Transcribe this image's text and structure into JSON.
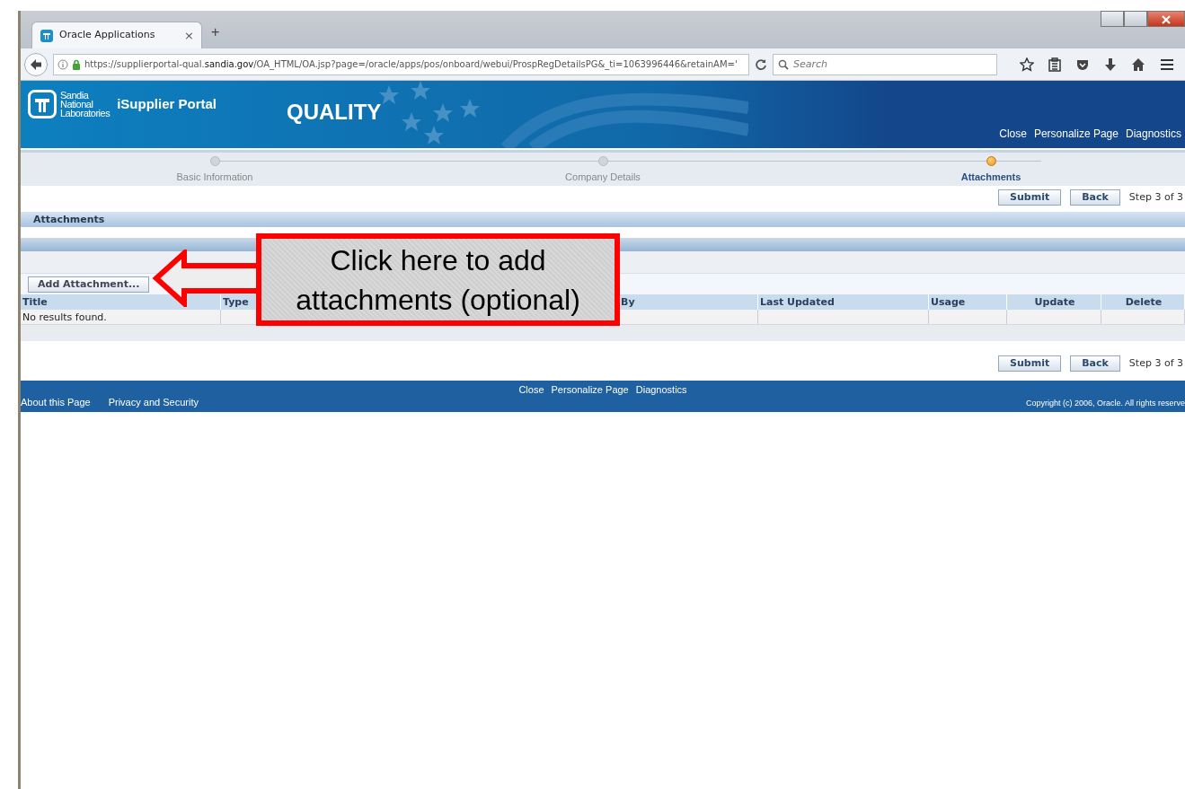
{
  "browser": {
    "tab": {
      "title": "Oracle Applications",
      "close": "×",
      "new_tab": "+"
    },
    "address": {
      "prefix": "https://supplierportal-qual.",
      "domain": "sandia.gov",
      "path": "/OA_HTML/OA.jsp?page=/oracle/apps/pos/onboard/webui/ProspRegDetailsPG&_ti=1063996446&retainAM='"
    },
    "search": {
      "placeholder": "Search"
    }
  },
  "header": {
    "org_lines": [
      "Sandia",
      "National",
      "Laboratories"
    ],
    "portal": "iSupplier Portal",
    "environment": "QUALITY",
    "links": [
      "Close",
      "Personalize Page",
      "Diagnostics"
    ]
  },
  "train": [
    {
      "label": "Basic Information",
      "selected": false
    },
    {
      "label": "Company Details",
      "selected": false
    },
    {
      "label": "Attachments",
      "selected": true
    }
  ],
  "actions": {
    "submit": "Submit",
    "back": "Back",
    "step": "Step 3 of 3"
  },
  "section": {
    "title": "Attachments"
  },
  "add_button": "Add Attachment...",
  "table": {
    "columns": [
      "Title",
      "Type",
      "By",
      "Last Updated",
      "Usage",
      "Update",
      "Delete"
    ],
    "empty_text": "No results found."
  },
  "bottom_actions": {
    "submit": "Submit",
    "back": "Back",
    "step": "Step 3 of 3"
  },
  "footer": {
    "center_links": [
      "Close",
      "Personalize Page",
      "Diagnostics"
    ],
    "left_links": [
      "About this Page",
      "Privacy and Security"
    ],
    "copyright": "Copyright (c) 2006, Oracle. All rights reserve"
  },
  "callout": {
    "text": "Click here to add attachments (optional)"
  }
}
